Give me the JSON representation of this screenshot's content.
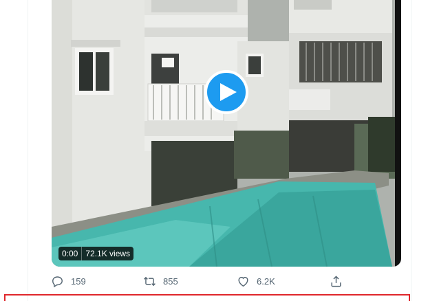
{
  "video": {
    "timestamp": "0:00",
    "views": "72.1K views"
  },
  "actions": {
    "reply_count": "159",
    "retweet_count": "855",
    "like_count": "6.2K"
  },
  "colors": {
    "accent": "#1d9bf0",
    "action_text": "#536471",
    "highlight_border": "#e0262b"
  },
  "icons": {
    "play": "play-icon",
    "reply": "reply-icon",
    "retweet": "retweet-icon",
    "like": "heart-icon",
    "share": "share-icon"
  }
}
